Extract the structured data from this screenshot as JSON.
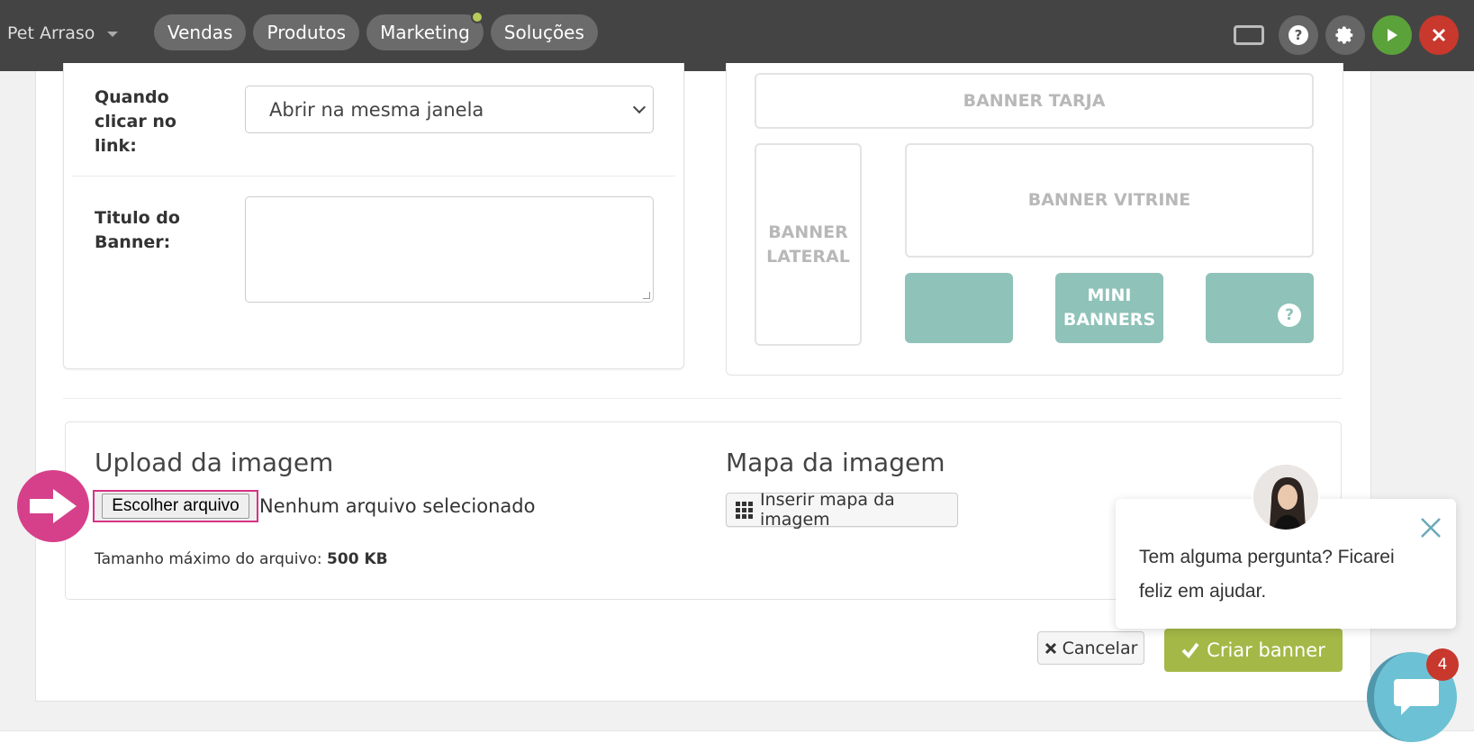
{
  "topbar": {
    "store_name": "Pet Arraso",
    "nav": [
      "Vendas",
      "Produtos",
      "Marketing",
      "Soluções"
    ]
  },
  "form": {
    "click_label": "Quando clicar no link:",
    "click_select_value": "Abrir na mesma janela",
    "title_label": "Titulo do Banner:"
  },
  "preview": {
    "tarja": "BANNER TARJA",
    "lateral": "BANNER LATERAL",
    "vitrine": "BANNER VITRINE",
    "mini": "MINI BANNERS",
    "help_glyph": "?"
  },
  "upload": {
    "title": "Upload da imagem",
    "choose_button": "Escolher arquivo",
    "no_file": "Nenhum arquivo selecionado",
    "max_label": "Tamanho máximo do arquivo:",
    "max_value": "500 KB"
  },
  "map": {
    "title": "Mapa da imagem",
    "insert_button": "Inserir mapa da imagem"
  },
  "actions": {
    "cancel": "Cancelar",
    "create": "Criar banner"
  },
  "chat": {
    "message": "Tem alguma pergunta? Ficarei feliz em ajudar.",
    "badge_count": "4"
  },
  "colors": {
    "topbar": "#444444",
    "play": "#5ca23b",
    "close": "#c8382d",
    "teal_banner": "#8fc2b8",
    "create_button": "#a4b847",
    "highlight": "#d63384"
  }
}
